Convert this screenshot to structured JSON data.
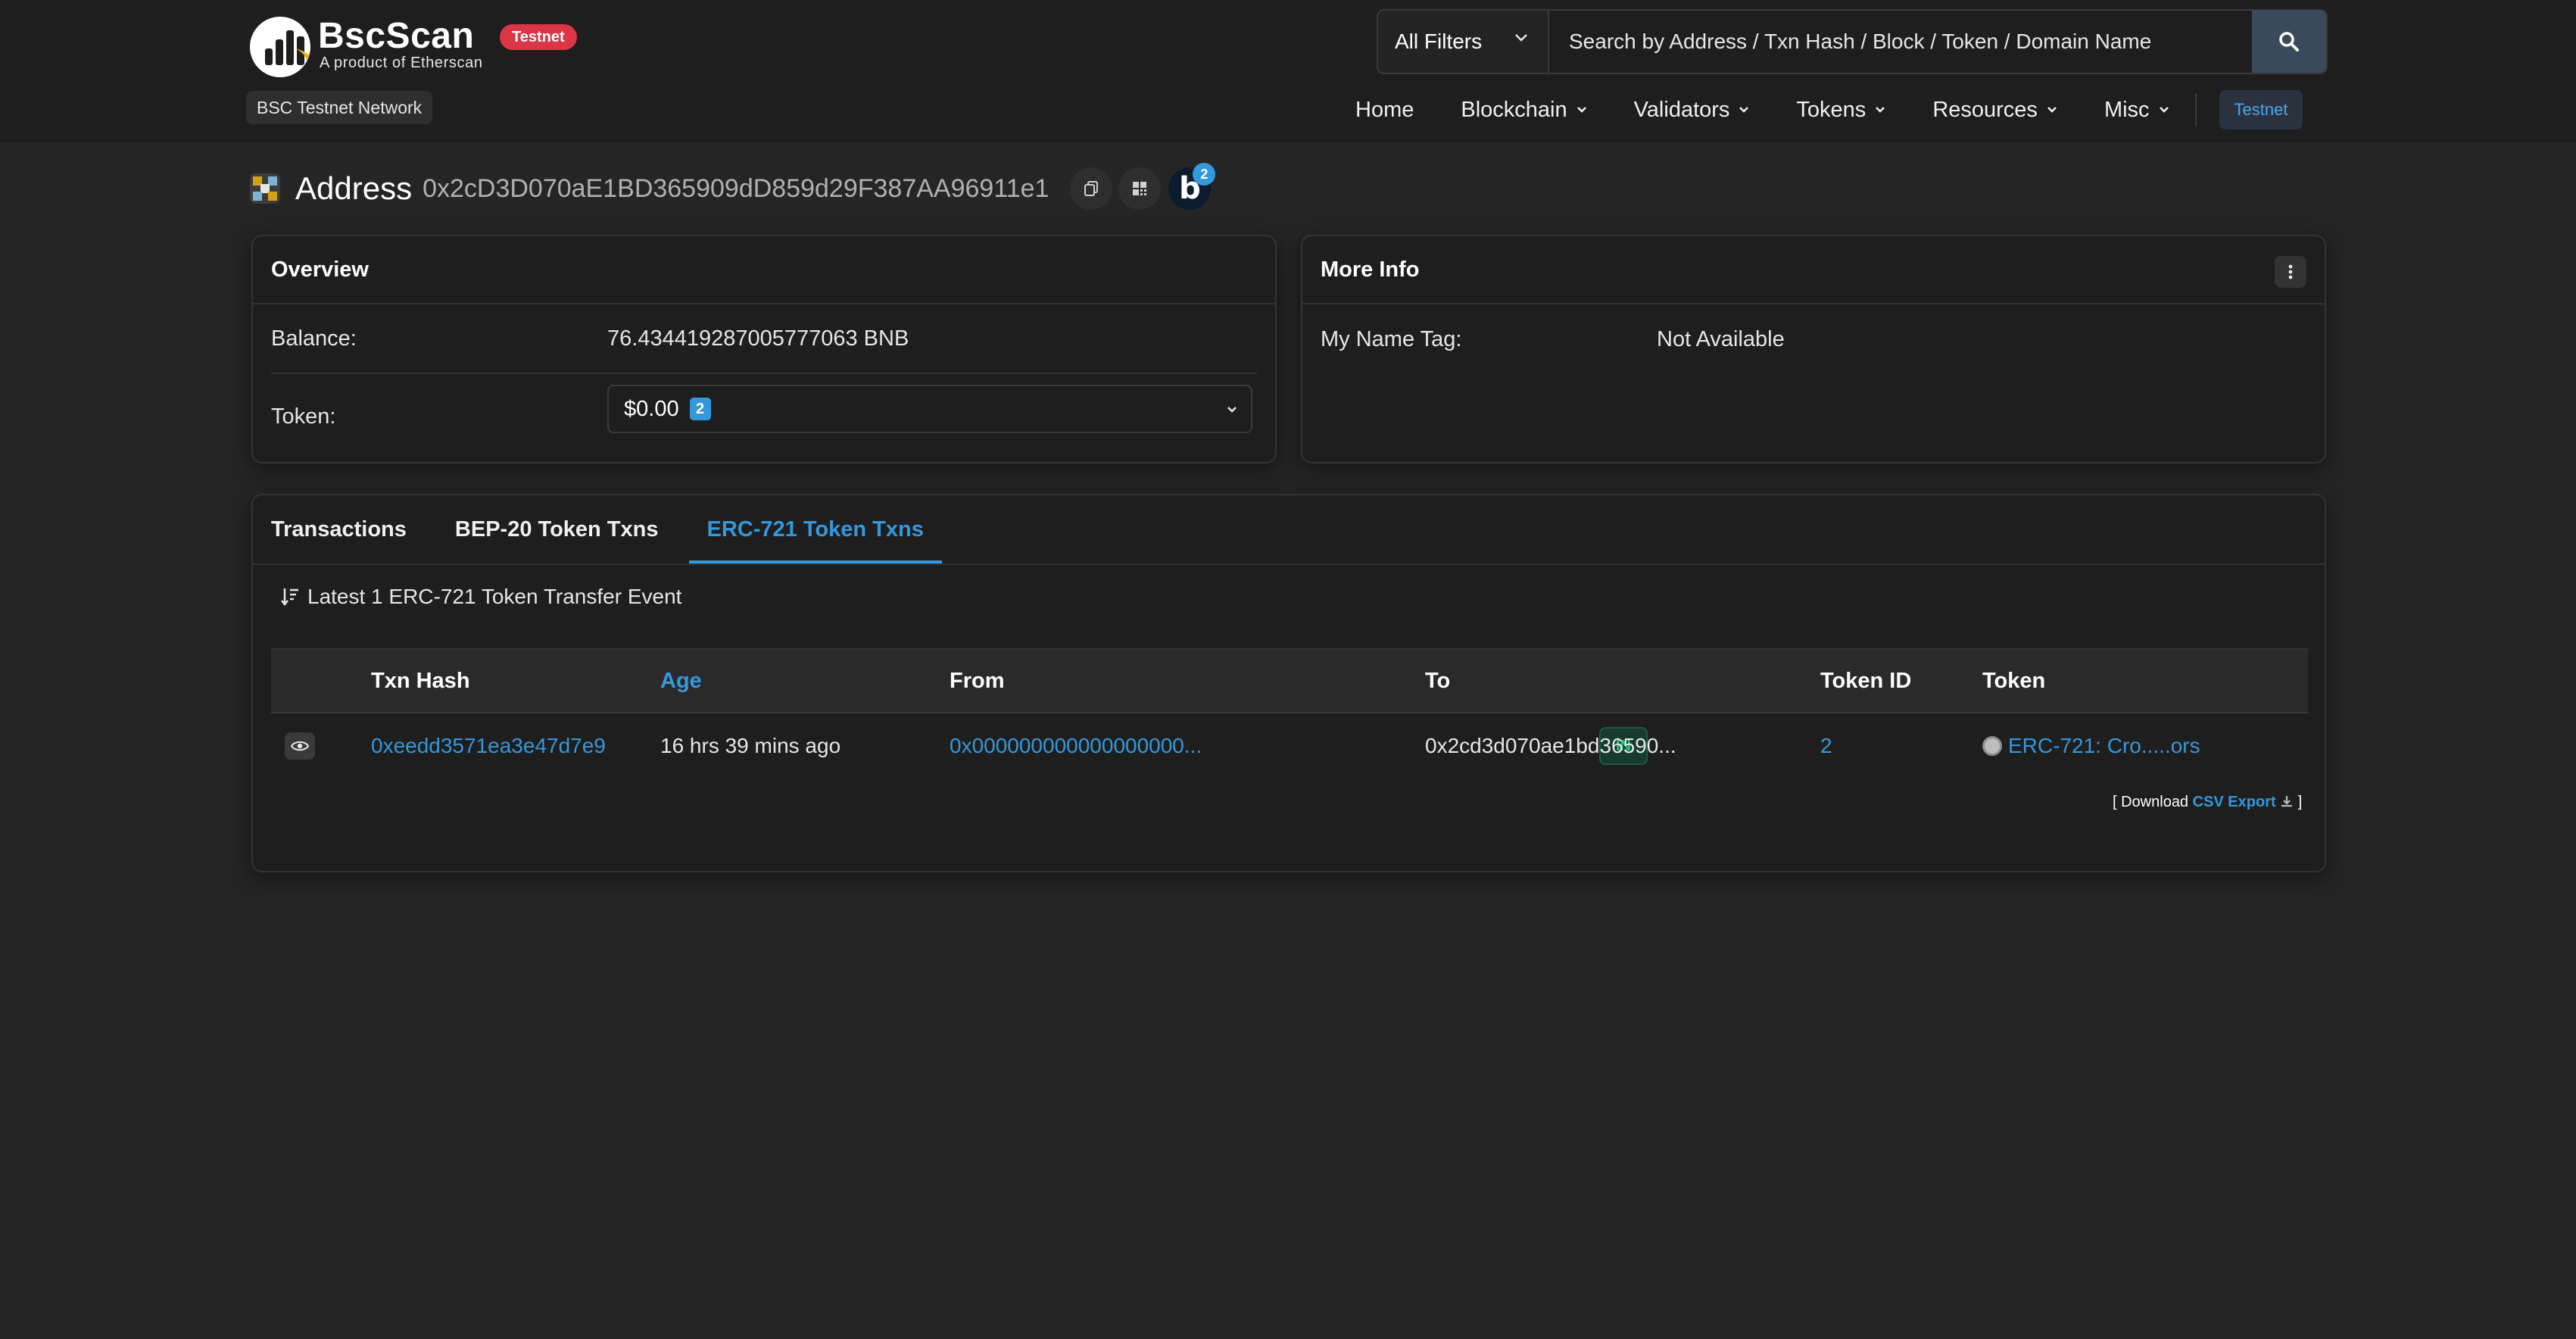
{
  "header": {
    "logo_name": "BscScan",
    "logo_sub": "A product of Etherscan",
    "env_badge": "Testnet",
    "network": "BSC Testnet Network",
    "search": {
      "filter": "All Filters",
      "placeholder": "Search by Address / Txn Hash / Block / Token / Domain Name"
    },
    "nav": [
      {
        "label": "Home",
        "dropdown": false
      },
      {
        "label": "Blockchain",
        "dropdown": true
      },
      {
        "label": "Validators",
        "dropdown": true
      },
      {
        "label": "Tokens",
        "dropdown": true
      },
      {
        "label": "Resources",
        "dropdown": true
      },
      {
        "label": "Misc",
        "dropdown": true
      }
    ],
    "testnet_button": "Testnet"
  },
  "address": {
    "label": "Address",
    "value": "0x2cD3D070aE1BD365909dD859d29F387AA96911e1",
    "blockscan_letter": "b",
    "blockscan_count": "2"
  },
  "overview": {
    "title": "Overview",
    "balance_label": "Balance:",
    "balance_value": "76.434419287005777063 BNB",
    "token_label": "Token:",
    "token_value": "$0.00",
    "token_count": "2"
  },
  "more_info": {
    "title": "More Info",
    "name_tag_label": "My Name Tag:",
    "name_tag_value": "Not Available"
  },
  "tabs": [
    "Transactions",
    "BEP-20 Token Txns",
    "ERC-721 Token Txns"
  ],
  "active_tab": 2,
  "list_caption": "Latest 1 ERC-721 Token Transfer Event",
  "table": {
    "headers": {
      "txn_hash": "Txn Hash",
      "age": "Age",
      "from": "From",
      "to": "To",
      "token_id": "Token ID",
      "token": "Token"
    },
    "rows": [
      {
        "txn_hash": "0xeedd3571ea3e47d7e9",
        "age": "16 hrs 39 mins ago",
        "from": "0x000000000000000000...",
        "direction": "IN",
        "to": "0x2cd3d070ae1bd36590...",
        "token_id": "2",
        "token": "ERC-721: Cro.....ors"
      }
    ]
  },
  "download": {
    "prefix": "[ Download",
    "link": "CSV Export",
    "suffix": "]"
  },
  "colors": {
    "background": "#252525",
    "panel": "#1e1e1e",
    "link": "#3498db",
    "badge_red": "#dc3545",
    "in_green": "#28c98a",
    "brand_yellow": "#f0b90b"
  },
  "icons": [
    "search-icon",
    "chevron-down-icon",
    "copy-icon",
    "qr-code-icon",
    "kebab-menu-icon",
    "sort-icon",
    "eye-icon",
    "download-icon"
  ]
}
